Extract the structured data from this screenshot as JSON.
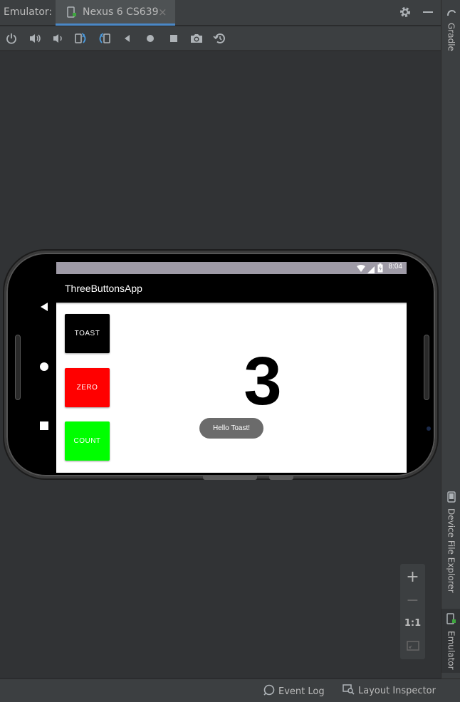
{
  "header": {
    "title": "Emulator:",
    "tab_label": "Nexus 6 CS639",
    "tab_close": "×"
  },
  "toolbar": {
    "icons": [
      "power-icon",
      "volume-up-icon",
      "volume-down-icon",
      "rotate-left-icon",
      "rotate-right-icon",
      "back-icon",
      "home-icon",
      "overview-icon",
      "camera-icon",
      "snapshot-icon"
    ]
  },
  "right_sidebar": {
    "top_tab": "Gradle",
    "device_explorer_tab": "Device File Explorer",
    "emulator_tab": "Emulator"
  },
  "status_bar": {
    "event_log": "Event Log",
    "layout_inspector": "Layout Inspector"
  },
  "device": {
    "clock": "8:04",
    "app_title": "ThreeButtonsApp",
    "buttons": [
      {
        "label": "TOAST",
        "bg": "#000000",
        "fg": "#ffffff"
      },
      {
        "label": "ZERO",
        "bg": "#ff0000",
        "fg": "#ffffff"
      },
      {
        "label": "COUNT",
        "bg": "#00ff00",
        "fg": "#ffffff"
      }
    ],
    "count_value": "3",
    "toast_message": "Hello Toast!"
  },
  "zoom_panel": {
    "zoom_in": "+",
    "zoom_out": "−",
    "actual_size": "1:1"
  },
  "colors": {
    "accent": "#4a88c7",
    "panel": "#3c3f41",
    "background": "#313335"
  }
}
